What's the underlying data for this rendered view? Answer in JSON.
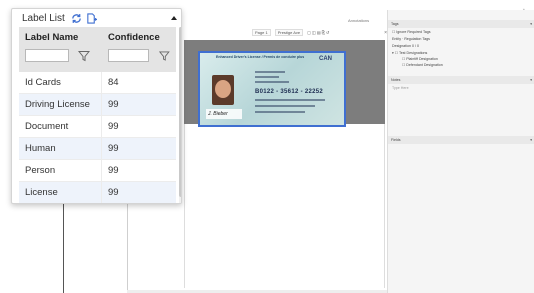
{
  "label_list": {
    "title": "Label List",
    "columns": {
      "name": "Label Name",
      "confidence": "Confidence"
    },
    "filters": {
      "name_value": "",
      "confidence_value": ""
    },
    "rows": [
      {
        "name": "Id Cards",
        "confidence": "84"
      },
      {
        "name": "Driving License",
        "confidence": "99"
      },
      {
        "name": "Document",
        "confidence": "99"
      },
      {
        "name": "Human",
        "confidence": "99"
      },
      {
        "name": "Person",
        "confidence": "99"
      },
      {
        "name": "License",
        "confidence": "99"
      }
    ]
  },
  "viewer": {
    "top_tab": "Annotations",
    "toolbar": {
      "page": "Page 1",
      "zoom": "Prestige Ave",
      "close": "×"
    },
    "card": {
      "header": "Enhanced Driver's License / Permis de conduire plus",
      "country": "CAN",
      "number": "B0122 - 35612 - 22252",
      "signature": "J. Bieber"
    }
  },
  "properties": {
    "tags_header": "Tags",
    "ignore_required": "Ignore Required Tags",
    "entity_label": "Entity",
    "entity_value": "Regulation Tags",
    "designation_label": "Designation",
    "designation_value": "0 / 0",
    "test_designations": "Test Designations",
    "plaintiff": "Plaintiff Designation",
    "defendant": "Defendant Designation",
    "notes_header": "Notes",
    "notes_placeholder": "Type Here",
    "fields_header": "Fields"
  },
  "colors": {
    "accent": "#3f6fd1",
    "row_alt": "#eef3fb",
    "header_bg": "#e4e4e4"
  },
  "icons": {
    "refresh": "refresh-icon",
    "add": "add-document-icon",
    "collapse": "collapse-caret-icon",
    "filter": "filter-funnel-icon"
  }
}
